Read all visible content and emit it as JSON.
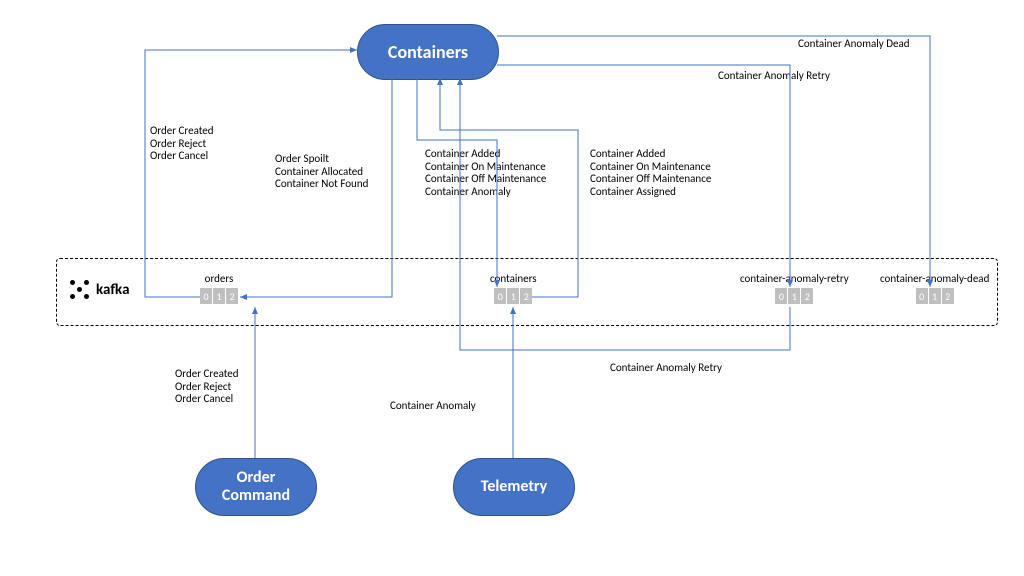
{
  "services": {
    "containers": "Containers",
    "order_command": "Order\nCommand",
    "telemetry": "Telemetry"
  },
  "bus": {
    "label": "kafka"
  },
  "topics": {
    "orders": {
      "name": "orders",
      "partitions": [
        "0",
        "1",
        "2"
      ]
    },
    "containers": {
      "name": "containers",
      "partitions": [
        "0",
        "1",
        "2"
      ]
    },
    "retry": {
      "name": "container-anomaly-retry",
      "partitions": [
        "0",
        "1",
        "2"
      ]
    },
    "dead": {
      "name": "container-anomaly-dead",
      "partitions": [
        "0",
        "1",
        "2"
      ]
    }
  },
  "labels": {
    "order_events_top": "Order Created\nOrder Reject\nOrder Cancel",
    "order_spoilt": "Order Spoilt\nContainer Allocated\nContainer Not Found",
    "container_out": "Container Added\nContainer On Maintenance\nContainer Off Maintenance\nContainer Anomaly",
    "container_in": "Container Added\nContainer On Maintenance\nContainer Off Maintenance\nContainer Assigned",
    "retry_top": "Container Anomaly Retry",
    "dead_top": "Container Anomaly Dead",
    "order_events_bottom": "Order Created\nOrder Reject\nOrder Cancel",
    "container_anomaly": "Container Anomaly",
    "retry_bottom": "Container Anomaly Retry"
  }
}
